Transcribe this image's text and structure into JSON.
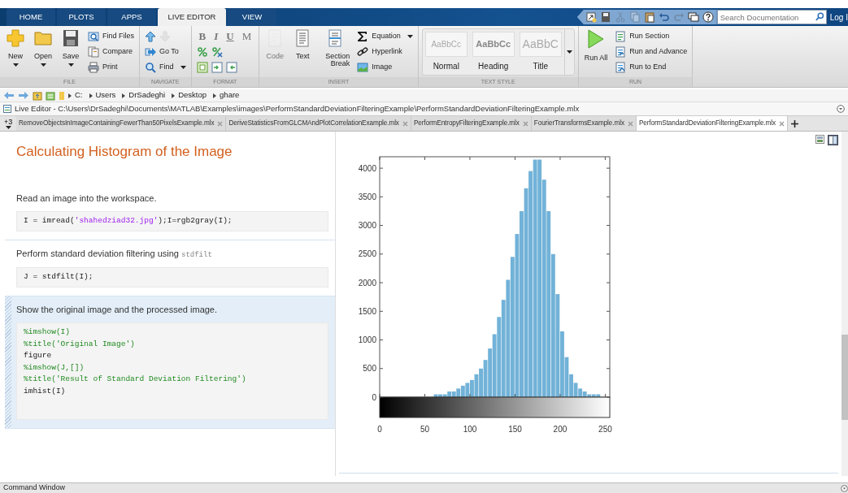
{
  "top_tabs": [
    {
      "label": "HOME",
      "selected": false
    },
    {
      "label": "PLOTS",
      "selected": false
    },
    {
      "label": "APPS",
      "selected": false
    },
    {
      "label": "LIVE EDITOR",
      "selected": true
    },
    {
      "label": "VIEW",
      "selected": false
    }
  ],
  "quick_access": [
    {
      "disabled": false
    },
    {
      "disabled": false
    },
    {
      "disabled": true
    },
    {
      "disabled": true
    },
    {
      "disabled": false
    },
    {
      "disabled": false
    },
    {
      "disabled": true
    },
    {
      "disabled": false
    },
    {
      "disabled": false
    }
  ],
  "search": {
    "placeholder": "Search Documentation"
  },
  "login": {
    "label": "Log I"
  },
  "toolstrip": [
    {
      "label": "FILE",
      "columns": [
        {
          "kind": "large",
          "label": "New",
          "dropdown": true,
          "disabled": false
        },
        {
          "kind": "large",
          "label": "Open",
          "dropdown": true,
          "disabled": false
        },
        {
          "kind": "large",
          "label": "Save",
          "dropdown": true,
          "disabled": false
        },
        {
          "kind": "stack",
          "rows": [
            [
              {
                "label": "Find Files",
                "disabled": false
              }
            ],
            [
              {
                "label": "Compare",
                "disabled": false
              }
            ],
            [
              {
                "label": "Print",
                "disabled": false
              }
            ]
          ]
        }
      ]
    },
    {
      "label": "NAVIGATE",
      "columns": [
        {
          "kind": "stack",
          "rows": [
            [
              {
                "disabled": false
              },
              {
                "disabled": true
              }
            ],
            [
              {
                "label": "Go To",
                "disabled": false
              }
            ],
            [
              {
                "label": "Find",
                "dropdown": true,
                "disabled": false
              }
            ]
          ]
        }
      ]
    },
    {
      "label": "FORMAT",
      "columns": [
        {
          "kind": "stack",
          "rows": [
            [
              {
                "label": "B",
                "disabled": true
              },
              {
                "label": "I",
                "disabled": true
              },
              {
                "label": "U",
                "disabled": true
              },
              {
                "label": "M",
                "disabled": true
              }
            ],
            [
              {
                "disabled": false
              },
              {
                "disabled": false
              }
            ],
            [
              {
                "disabled": false
              },
              {
                "disabled": false
              },
              {
                "disabled": false
              }
            ]
          ]
        }
      ]
    },
    {
      "label": "INSERT",
      "columns": [
        {
          "kind": "large",
          "label": "Code",
          "disabled": true
        },
        {
          "kind": "large",
          "label": "Text",
          "disabled": false
        },
        {
          "kind": "large",
          "label": "Section Break",
          "disabled": false
        },
        {
          "kind": "stack",
          "rows": [
            [
              {
                "label": "Equation",
                "dropdown": true,
                "disabled": false
              }
            ],
            [
              {
                "label": "Hyperlink",
                "disabled": false
              }
            ],
            [
              {
                "label": "Image",
                "disabled": false
              }
            ]
          ]
        }
      ]
    },
    {
      "label": "TEXT STYLE",
      "columns": [
        {
          "kind": "gallery",
          "styles": [
            {
              "preview": "AaBbCc",
              "label": "Normal",
              "kind": "normal"
            },
            {
              "preview": "AaBbCc",
              "label": "Heading",
              "kind": "heading"
            },
            {
              "preview": "AaBbC",
              "label": "Title",
              "kind": "title"
            }
          ]
        }
      ]
    },
    {
      "label": "RUN",
      "columns": [
        {
          "kind": "large",
          "label": "Run All",
          "disabled": false
        },
        {
          "kind": "stack",
          "rows": [
            [
              {
                "label": "Run Section",
                "disabled": false
              }
            ],
            [
              {
                "label": "Run and Advance",
                "disabled": false
              }
            ],
            [
              {
                "label": "Run to End",
                "disabled": false
              }
            ]
          ]
        }
      ]
    }
  ],
  "breadcrumbs": [
    "C:",
    "Users",
    "DrSadeghi",
    "Desktop",
    "ghare"
  ],
  "editor_title": "Live Editor - C:\\Users\\DrSadeghi\\Documents\\MATLAB\\Examples\\images\\PerformStandardDeviationFilteringExample\\PerformStandardDeviationFilteringExample.mlx",
  "doc_tabs": {
    "overflow": "+3",
    "tabs": [
      {
        "label": "RemoveObjectsInImageContainingFewerThan50PixelsExample.mlx",
        "selected": false
      },
      {
        "label": "DeriveStatisticsFromGLCMAndPlotCorrelationExample.mlx",
        "selected": false
      },
      {
        "label": "PerformEntropyFilteringExample.mlx",
        "selected": false
      },
      {
        "label": "FourierTransformsExample.mlx",
        "selected": false
      },
      {
        "label": "PerformStandardDeviationFilteringExample.mlx",
        "selected": true
      }
    ]
  },
  "script": {
    "heading": "Calculating Histogram of the Image",
    "sections": [
      {
        "selected": false,
        "text": "Read an image into the workspace.",
        "code": [
          [
            {
              "text": "I = imread(",
              "kind": "plain"
            },
            {
              "text": "'shahedziad32.jpg'",
              "kind": "string"
            },
            {
              "text": ");I=rgb2gray(I);",
              "kind": "plain"
            }
          ]
        ]
      },
      {
        "selected": false,
        "text": "Perform standard deviation filtering using ",
        "inline_code": "stdfilt",
        "code": [
          [
            {
              "text": "J = stdfilt(I);",
              "kind": "plain"
            }
          ]
        ]
      },
      {
        "selected": true,
        "text": "Show the original image and the processed image.",
        "code": [
          [
            {
              "text": "%imshow(I)",
              "kind": "comment"
            }
          ],
          [
            {
              "text": "%title('Original Image')",
              "kind": "comment"
            }
          ],
          [
            {
              "text": "figure",
              "kind": "plain"
            }
          ],
          [
            {
              "text": "%imshow(J,[])",
              "kind": "comment"
            }
          ],
          [
            {
              "text": "%title('Result of Standard Deviation Filtering')",
              "kind": "comment"
            }
          ],
          [
            {
              "text": "imhist(I)",
              "kind": "plain"
            }
          ]
        ]
      }
    ]
  },
  "output": {
    "chart_data": {
      "type": "bar",
      "x": [
        0,
        5,
        10,
        15,
        20,
        25,
        30,
        35,
        40,
        45,
        50,
        55,
        60,
        65,
        70,
        75,
        80,
        85,
        90,
        95,
        100,
        105,
        110,
        115,
        120,
        125,
        130,
        135,
        140,
        145,
        150,
        155,
        160,
        165,
        170,
        175,
        180,
        185,
        190,
        195,
        200,
        205,
        210,
        215,
        220,
        225,
        230,
        235,
        240,
        245,
        250
      ],
      "values": [
        0,
        0,
        0,
        0,
        0,
        0,
        0,
        0,
        0,
        0,
        0,
        0,
        50,
        50,
        50,
        100,
        100,
        150,
        200,
        250,
        300,
        400,
        500,
        650,
        850,
        1100,
        1400,
        1700,
        2050,
        2450,
        2850,
        3250,
        3650,
        3950,
        4150,
        4150,
        3800,
        3250,
        2500,
        1800,
        1150,
        700,
        400,
        250,
        150,
        100,
        50,
        50,
        50,
        0,
        0
      ],
      "xlim": [
        0,
        255
      ],
      "ylim": [
        0,
        4200
      ],
      "xticks": [
        0,
        50,
        100,
        150,
        200,
        250
      ],
      "yticks": [
        0,
        500,
        1000,
        1500,
        2000,
        2500,
        3000,
        3500,
        4000
      ]
    }
  },
  "command_window": {
    "title": "Command Window"
  }
}
